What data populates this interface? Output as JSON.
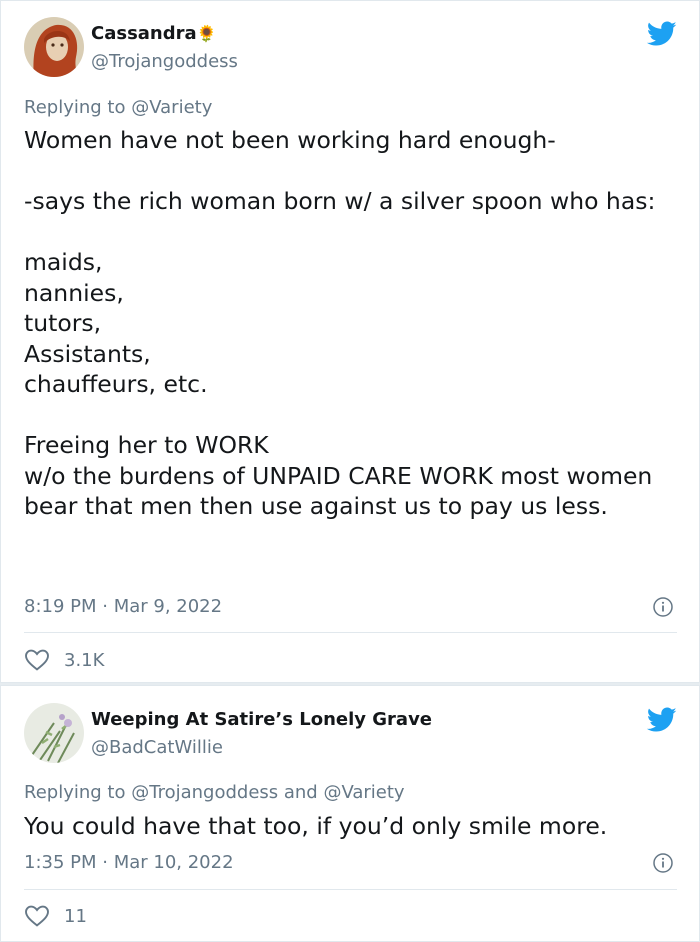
{
  "tweets": [
    {
      "name": "Cassandra",
      "name_emoji": "🌻",
      "handle": "@Trojangoddess",
      "replying_prefix": "Replying to",
      "replying_to": "@Variety",
      "text": "Women have not been working hard enough-\n\n-says the rich woman born w/ a silver spoon who has:\n\nmaids,\nnannies,\ntutors,\nAssistants,\nchauffeurs, etc.\n\nFreeing her to WORK\nw/o the burdens of UNPAID CARE WORK most women bear that men then use against us to pay us less.",
      "timestamp": "8:19 PM · Mar 9, 2022",
      "likes": "3.1K"
    },
    {
      "name": "Weeping At Satire’s Lonely Grave",
      "handle": "@BadCatWillie",
      "replying_prefix": "Replying to",
      "replying_to": "@Trojangoddess and @Variety",
      "text": "You could have that too, if you’d only smile more.",
      "timestamp": "1:35 PM · Mar 10, 2022",
      "likes": "11"
    }
  ],
  "colors": {
    "twitter_blue": "#1da1f2",
    "secondary_text": "#657786",
    "primary_text": "#14171a"
  },
  "icons": [
    "twitter-bird-icon",
    "info-icon",
    "heart-icon"
  ]
}
